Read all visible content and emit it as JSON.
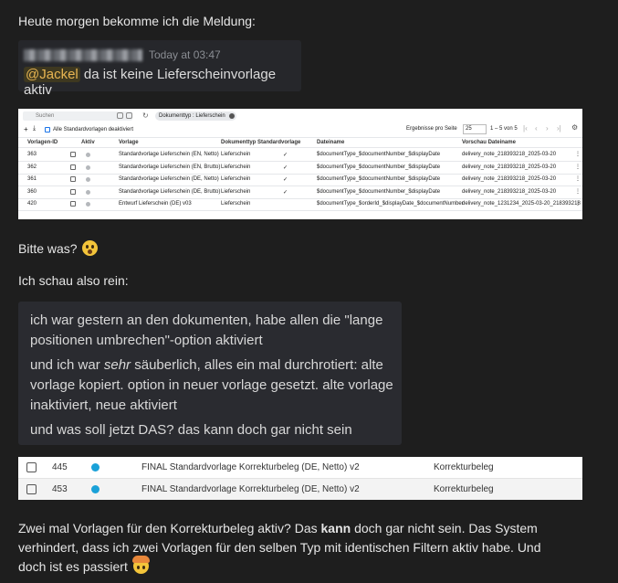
{
  "intro": "Heute morgen bekomme ich die Meldung:",
  "chat": {
    "time": "Today at 03:47",
    "mention": "@Jackel",
    "message": "da ist keine Lieferscheinvorlage aktiv"
  },
  "table1": {
    "search_placeholder": "Suchen",
    "filter_chip": "Dokumenttyp : Lieferschein",
    "deactivate_all": "Alle Standardvorlagen deaktiviert",
    "results_per_page_label": "Ergebnisse pro Seite",
    "results_per_page": "25",
    "pagination": "1 – 5 von 5",
    "headers": [
      "Vorlagen-ID",
      "Aktiv",
      "Vorlage",
      "Dokumenttyp",
      "Standardvorlage",
      "Dateiname",
      "Vorschau Dateiname"
    ],
    "rows": [
      {
        "id": "363",
        "aktiv": "grey",
        "vorlage": "Standardvorlage Lieferschein (EN, Netto)",
        "typ": "Lieferschein",
        "standard": "✓",
        "dateiname": "$documentType_$documentNumber_$displayDate",
        "vorschau": "delivery_note_218393218_2025-03-20"
      },
      {
        "id": "362",
        "aktiv": "grey",
        "vorlage": "Standardvorlage Lieferschein (EN, Brutto)",
        "typ": "Lieferschein",
        "standard": "✓",
        "dateiname": "$documentType_$documentNumber_$displayDate",
        "vorschau": "delivery_note_218393218_2025-03-20"
      },
      {
        "id": "361",
        "aktiv": "grey",
        "vorlage": "Standardvorlage Lieferschein (DE, Netto)",
        "typ": "Lieferschein",
        "standard": "✓",
        "dateiname": "$documentType_$documentNumber_$displayDate",
        "vorschau": "delivery_note_218393218_2025-03-20"
      },
      {
        "id": "360",
        "aktiv": "grey",
        "vorlage": "Standardvorlage Lieferschein (DE, Brutto)",
        "typ": "Lieferschein",
        "standard": "✓",
        "dateiname": "$documentType_$documentNumber_$displayDate",
        "vorschau": "delivery_note_218393218_2025-03-20"
      },
      {
        "id": "420",
        "aktiv": "grey",
        "vorlage": "Entwurf Lieferschein (DE) v03",
        "typ": "Lieferschein",
        "standard": "",
        "dateiname": "$documentType_$orderId_$displayDate_$documentNumber",
        "vorschau": "delivery_note_1231234_2025-03-20_218393218"
      }
    ]
  },
  "bitte": "Bitte was?",
  "schau": "Ich schau also rein:",
  "quote": {
    "line1": "ich war gestern an den dokumenten, habe allen die \"lange",
    "line2": "positionen umbrechen\"-option aktiviert",
    "line3_a": "und ich war ",
    "line3_em": "sehr",
    "line3_b": " säuberlich, alles ein mal durchrotiert: alte",
    "line4": "vorlage kopiert. option in neuer vorlage gesetzt. alte vorlage",
    "line5": "inaktiviert, neue aktiviert",
    "line6": "und was soll jetzt DAS? das kann doch gar nicht sein"
  },
  "table2": {
    "rows": [
      {
        "id": "445",
        "vorlage": "FINAL Standardvorlage Korrekturbeleg (DE, Netto) v2",
        "typ": "Korrekturbeleg"
      },
      {
        "id": "453",
        "vorlage": "FINAL Standardvorlage Korrekturbeleg (DE, Netto) v2",
        "typ": "Korrekturbeleg"
      }
    ]
  },
  "outro": {
    "a": "Zwei mal Vorlagen für den Korrekturbeleg aktiv? Das ",
    "b": "kann",
    "c": " doch gar nicht sein. Das System",
    "line2": "verhindert, dass ich zwei Vorlagen für den selben Typ mit identischen Filtern aktiv habe. Und",
    "line3": "doch ist es passiert"
  },
  "colors": {
    "active_dot": "#1aa1d8",
    "inactive_dot": "#b5b8bc",
    "mention_text": "#e8b552"
  }
}
